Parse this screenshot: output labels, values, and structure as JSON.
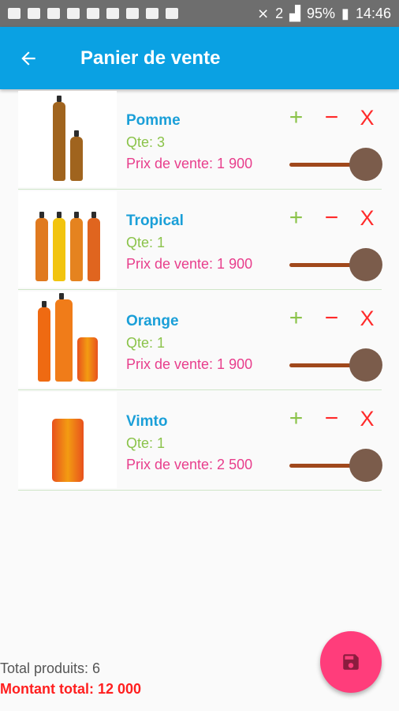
{
  "status_bar": {
    "battery": "95%",
    "time": "14:46",
    "sim": "2"
  },
  "app_bar": {
    "back_icon": "arrow-left-icon",
    "title": "Panier de vente"
  },
  "items": [
    {
      "name": "Pomme",
      "qty": "Qte: 3",
      "price": "Prix de vente: 1 900"
    },
    {
      "name": "Tropical",
      "qty": "Qte: 1",
      "price": "Prix de vente: 1 900"
    },
    {
      "name": "Orange",
      "qty": "Qte: 1",
      "price": "Prix de vente: 1 900"
    },
    {
      "name": "Vimto",
      "qty": "Qte: 1",
      "price": "Prix de vente: 2 500"
    }
  ],
  "actions": {
    "add": "+",
    "remove": "−",
    "delete": "X"
  },
  "footer": {
    "total_products": "Total produits: 6",
    "total_amount": "Montant total: 12 000"
  },
  "fab": {
    "icon": "save-icon"
  },
  "colors": {
    "app_bar": "#0aa1e3",
    "name": "#1a9fd8",
    "qty": "#8bc34a",
    "price": "#e83e8c",
    "fab": "#ff3d7b",
    "total_amount": "#ff1f1f"
  }
}
